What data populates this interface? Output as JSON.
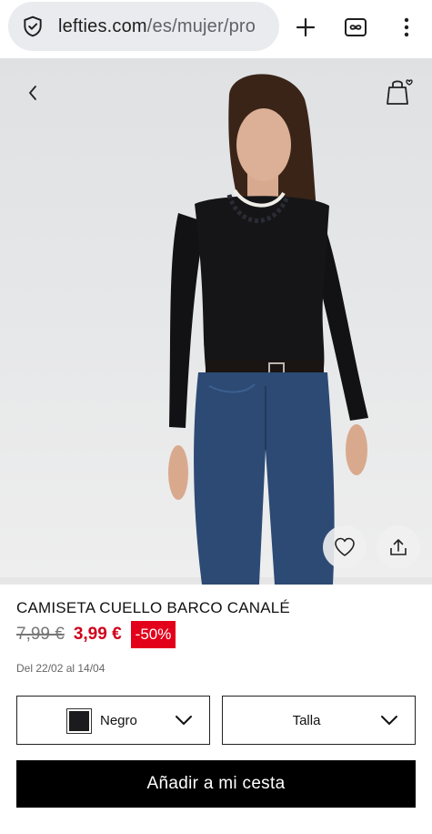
{
  "browser": {
    "url_host": "lefties.com",
    "url_path": "/es/mujer/pro",
    "security_icon": "shield-icon",
    "new_tab_icon": "plus-icon",
    "tabs_icon": "infinity-tabs-icon",
    "menu_icon": "more-vert-icon"
  },
  "product": {
    "title": "CAMISETA CUELLO BARCO CANALÉ",
    "old_price": "7,99 €",
    "price": "3,99 €",
    "discount": "-50%",
    "dates": "Del 22/02 al 14/04"
  },
  "options": {
    "color_label": "Negro",
    "color_swatch": "#1b1b1e",
    "size_label": "Talla"
  },
  "actions": {
    "add_to_cart": "Añadir a mi cesta"
  },
  "colors": {
    "accent_red": "#e3001b",
    "price_red": "#d0021b",
    "button_black": "#000000"
  }
}
